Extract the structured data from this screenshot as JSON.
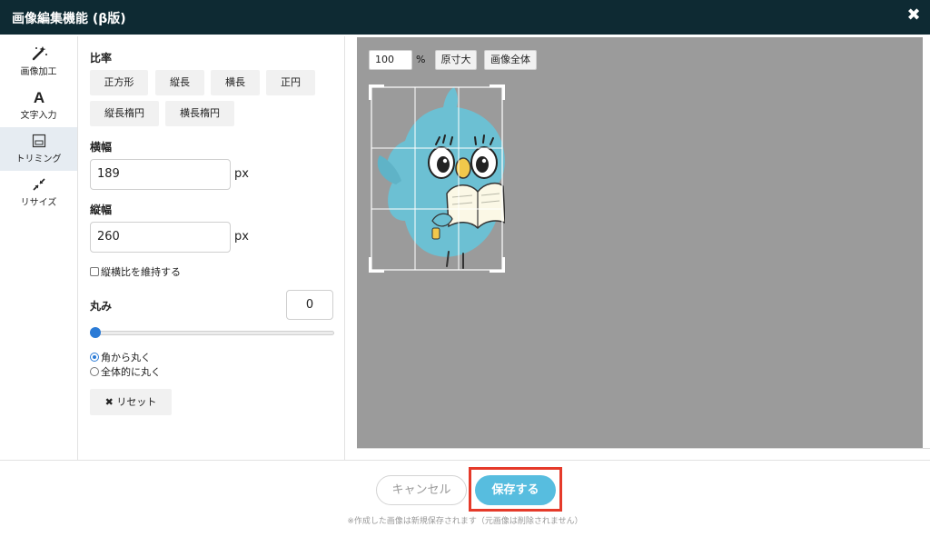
{
  "window": {
    "title": "画像編集機能 (β版)",
    "close_icon": "close-icon"
  },
  "sidebar": {
    "items": [
      {
        "label": "画像加工",
        "icon": "magic-wand-icon",
        "active": false
      },
      {
        "label": "文字入力",
        "icon": "text-a-icon",
        "active": false
      },
      {
        "label": "トリミング",
        "icon": "crop-frame-icon",
        "active": true
      },
      {
        "label": "リサイズ",
        "icon": "resize-arrows-icon",
        "active": false
      }
    ]
  },
  "panel": {
    "ratio_label": "比率",
    "ratio_buttons": [
      "正方形",
      "縦長",
      "横長",
      "正円",
      "縦長楕円",
      "横長楕円"
    ],
    "width_label": "横幅",
    "width_value": "189",
    "height_label": "縦幅",
    "height_value": "260",
    "unit": "px",
    "keep_ratio_label": "縦横比を維持する",
    "keep_ratio_checked": false,
    "rounding_label": "丸み",
    "rounding_value": "0",
    "rounding_level": 0,
    "round_options": [
      {
        "label": "角から丸く",
        "selected": true
      },
      {
        "label": "全体的に丸く",
        "selected": false
      }
    ],
    "reset_label": "リセット",
    "reset_icon": "x-icon"
  },
  "canvas": {
    "zoom_value": "100",
    "zoom_unit": "%",
    "original_size_label": "原寸大",
    "fit_image_label": "画像全体"
  },
  "footer": {
    "cancel_label": "キャンセル",
    "save_label": "保存する",
    "note": "※作成した画像は新規保存されます（元画像は削除されません）"
  },
  "colors": {
    "titlebar": "#0e2a33",
    "save_button": "#57bddf",
    "highlight": "#e53a2a",
    "canvas_bg": "#9b9b9b",
    "bird": "#6cc0d3"
  }
}
